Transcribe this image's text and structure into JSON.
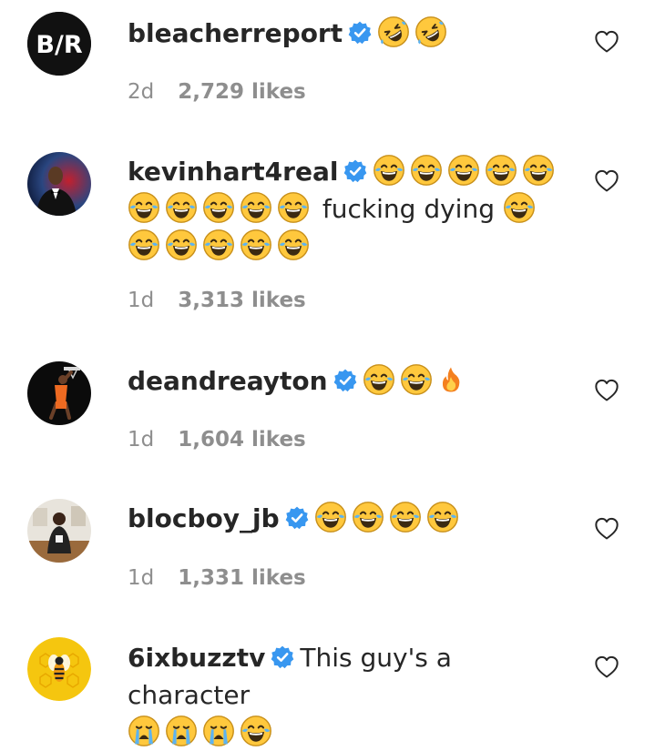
{
  "comments": [
    {
      "username": "bleacherreport",
      "message": "",
      "time": "2d",
      "likes": "2,729 likes",
      "avatar": "b-r-logo"
    },
    {
      "username": "kevinhart4real",
      "message": "fucking dying",
      "time": "1d",
      "likes": "3,313 likes",
      "avatar": "tuxedo-portrait"
    },
    {
      "username": "deandreayton",
      "message": "",
      "time": "1d",
      "likes": "1,604 likes",
      "avatar": "basketball-dunk-photo"
    },
    {
      "username": "blocboy_jb",
      "message": "",
      "time": "1d",
      "likes": "1,331 likes",
      "avatar": "room-portrait"
    },
    {
      "username": "6ixbuzztv",
      "message": "This guy's a character",
      "time": "",
      "likes": "",
      "avatar": "bee-logo"
    }
  ],
  "avatar_text": {
    "br": "B/R"
  },
  "colors": {
    "verified": "#3897f0",
    "meta": "#8e8e8e",
    "text": "#262626",
    "emoji": "#ffc83d"
  }
}
